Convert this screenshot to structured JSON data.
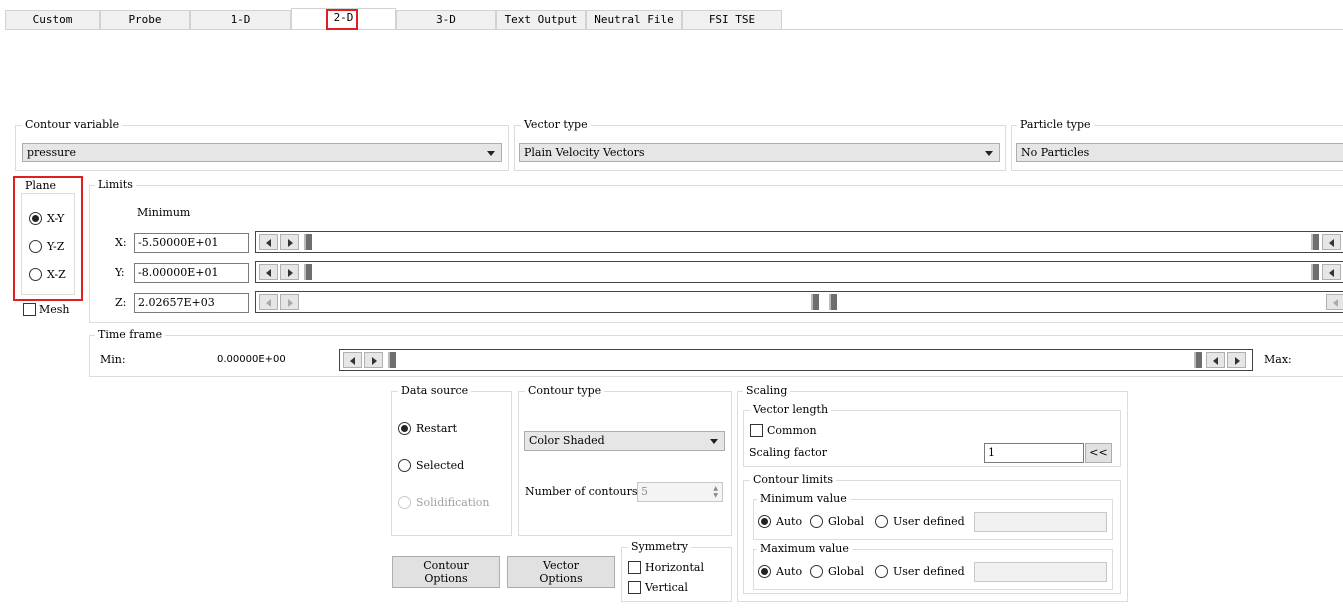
{
  "tabs": [
    {
      "label": "Custom"
    },
    {
      "label": "Probe"
    },
    {
      "label": "1-D"
    },
    {
      "label": "2-D"
    },
    {
      "label": "3-D"
    },
    {
      "label": "Text Output"
    },
    {
      "label": "Neutral File"
    },
    {
      "label": "FSI TSE"
    }
  ],
  "active_tab": "2-D",
  "contour_variable": {
    "title": "Contour variable",
    "value": "pressure"
  },
  "vector_type": {
    "title": "Vector type",
    "value": "Plain Velocity Vectors"
  },
  "particle_type": {
    "title": "Particle type",
    "value": "No Particles"
  },
  "plane": {
    "title": "Plane",
    "options": [
      "X-Y",
      "Y-Z",
      "X-Z"
    ],
    "selected": "X-Y"
  },
  "mesh": {
    "label": "Mesh",
    "checked": false
  },
  "limits": {
    "title": "Limits",
    "minimum_label": "Minimum",
    "rows": [
      {
        "axis": "X:",
        "value": "-5.50000E+01"
      },
      {
        "axis": "Y:",
        "value": "-8.00000E+01"
      },
      {
        "axis": "Z:",
        "value": "2.02657E+03"
      }
    ]
  },
  "time_frame": {
    "title": "Time frame",
    "min_label": "Min:",
    "min_value": "0.00000E+00",
    "max_label": "Max:"
  },
  "data_source": {
    "title": "Data source",
    "options": [
      {
        "label": "Restart",
        "selected": true,
        "enabled": true
      },
      {
        "label": "Selected",
        "selected": false,
        "enabled": true
      },
      {
        "label": "Solidification",
        "selected": false,
        "enabled": false
      }
    ]
  },
  "contour_type": {
    "title": "Contour type",
    "value": "Color Shaded",
    "num_contours_label": "Number of contours",
    "num_contours": "5"
  },
  "scaling": {
    "title": "Scaling",
    "vector_length": {
      "title": "Vector length",
      "common_label": "Common",
      "scaling_factor_label": "Scaling factor",
      "scaling_factor": "1",
      "button": "<<"
    },
    "contour_limits": {
      "title": "Contour limits",
      "minimum": {
        "title": "Minimum value",
        "options": [
          "Auto",
          "Global",
          "User defined"
        ],
        "selected": "Auto"
      },
      "maximum": {
        "title": "Maximum value",
        "options": [
          "Auto",
          "Global",
          "User defined"
        ],
        "selected": "Auto"
      }
    }
  },
  "buttons": {
    "contour_options": [
      "Contour",
      "Options"
    ],
    "vector_options": [
      "Vector",
      "Options"
    ]
  },
  "symmetry": {
    "title": "Symmetry",
    "horizontal": "Horizontal",
    "vertical": "Vertical"
  }
}
